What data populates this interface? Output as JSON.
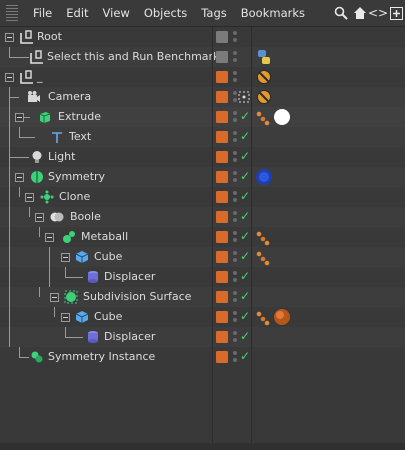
{
  "menu": [
    "File",
    "Edit",
    "View",
    "Objects",
    "Tags",
    "Bookmarks"
  ],
  "toolbar": [
    "search-icon",
    "home-icon",
    "link-arrows-icon",
    "add-icon"
  ],
  "rows": [
    {
      "label": "Root",
      "depth": 0,
      "icon": "null",
      "tags": []
    },
    {
      "label": "Select this and Run Benchmark",
      "depth": 1,
      "icon": "null",
      "tags": [
        "python"
      ]
    },
    {
      "label": "_",
      "depth": 0,
      "icon": "null",
      "tags": [
        "forbidden"
      ]
    },
    {
      "label": "Camera",
      "depth": 1,
      "icon": "camera",
      "tags": [
        "forbidden"
      ]
    },
    {
      "label": "Extrude",
      "depth": 1,
      "icon": "extrude",
      "tags": [
        "material-dots",
        "white-sphere"
      ]
    },
    {
      "label": "Text",
      "depth": 2,
      "icon": "text",
      "tags": []
    },
    {
      "label": "Light",
      "depth": 1,
      "icon": "light",
      "tags": []
    },
    {
      "label": "Symmetry",
      "depth": 1,
      "icon": "symmetry",
      "tags": [
        "blue-sphere"
      ]
    },
    {
      "label": "Clone",
      "depth": 2,
      "icon": "cloner",
      "tags": []
    },
    {
      "label": "Boole",
      "depth": 3,
      "icon": "boole",
      "tags": []
    },
    {
      "label": "Metaball",
      "depth": 4,
      "icon": "metaball",
      "tags": [
        "material-dots"
      ]
    },
    {
      "label": "Cube",
      "depth": 5,
      "icon": "cube",
      "tags": [
        "material-dots"
      ]
    },
    {
      "label": "Displacer",
      "depth": 6,
      "icon": "displacer",
      "tags": []
    },
    {
      "label": "Subdivision Surface",
      "depth": 4,
      "icon": "subdiv",
      "tags": []
    },
    {
      "label": "Cube",
      "depth": 5,
      "icon": "cube",
      "tags": [
        "material-dots",
        "orange-sphere"
      ]
    },
    {
      "label": "Displacer",
      "depth": 6,
      "icon": "displacer",
      "tags": []
    },
    {
      "label": "Symmetry Instance",
      "depth": 1,
      "icon": "instance",
      "tags": []
    }
  ],
  "colors": {
    "layer": "#d86a2a",
    "check": "#4bd56b",
    "bg": "#393939"
  }
}
